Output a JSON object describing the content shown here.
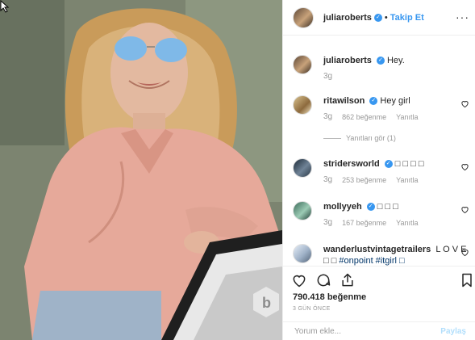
{
  "post": {
    "author": "juliaroberts",
    "follow_label": "Takip Et",
    "dot": "•",
    "more": "···"
  },
  "comments": [
    {
      "user": "juliaroberts",
      "text": "Hey.",
      "time": "3g"
    },
    {
      "user": "ritawilson",
      "text": "Hey girl",
      "time": "3g",
      "likes": "862 beğenme",
      "reply": "Yanıtla",
      "view_replies": "Yanıtları gör (1)"
    },
    {
      "user": "stridersworld",
      "text": "□ □ □ □",
      "time": "3g",
      "likes": "253 beğenme",
      "reply": "Yanıtla"
    },
    {
      "user": "mollyyeh",
      "text": "□ □ □",
      "time": "3g",
      "likes": "167 beğenme",
      "reply": "Yanıtla"
    },
    {
      "user": "wanderlustvintagetrailers",
      "text": "L O V E □ □",
      "hashtags": "#onpoint #itgirl □"
    }
  ],
  "stats": {
    "likes": "790.418 beğenme",
    "date": "3 GÜN ÖNCE"
  },
  "add_comment": {
    "placeholder": "Yorum ekle...",
    "post_label": "Paylaş"
  },
  "icons": [
    "heart-icon",
    "comment-icon",
    "share-icon",
    "bookmark-icon",
    "more-icon",
    "verified-icon"
  ],
  "colors": {
    "accent": "#3897f0",
    "muted": "#999999",
    "text": "#262626",
    "hashtag": "#003569"
  }
}
